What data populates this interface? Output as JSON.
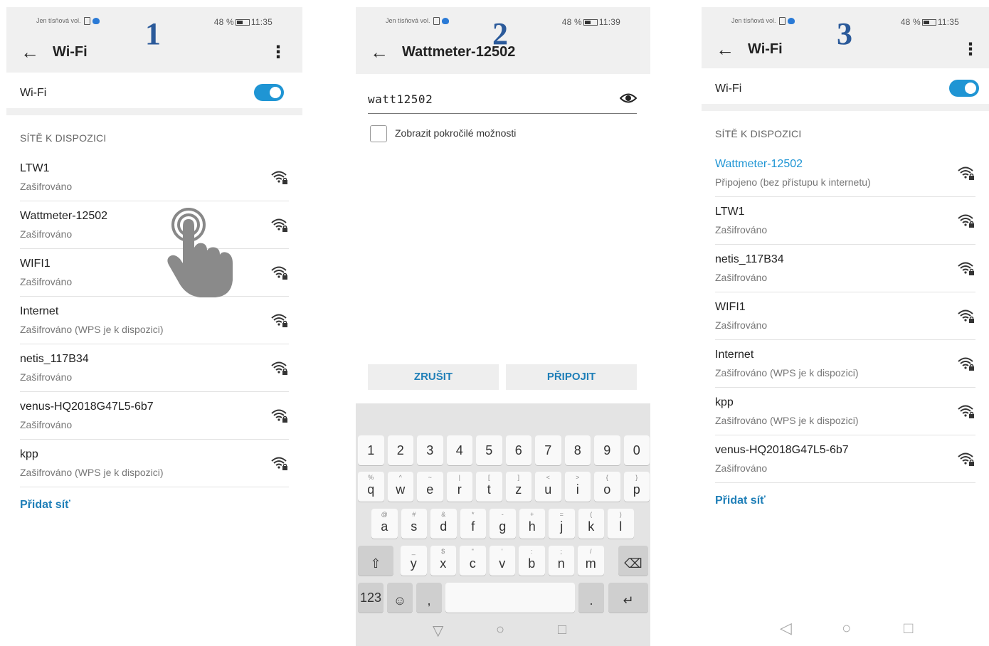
{
  "screens": [
    {
      "step": "1",
      "status": {
        "carrier": "Jen tísňová vol.",
        "battery": "48 %",
        "time": "11:35"
      },
      "title": "Wi-Fi",
      "wifi_label": "Wi-Fi",
      "wifi_on": true,
      "section": "SÍTĚ K DISPOZICI",
      "networks": [
        {
          "name": "LTW1",
          "sub": "Zašifrováno"
        },
        {
          "name": "Wattmeter-12502",
          "sub": "Zašifrováno"
        },
        {
          "name": "WIFI1",
          "sub": "Zašifrováno"
        },
        {
          "name": "Internet",
          "sub": "Zašifrováno (WPS je k dispozici)"
        },
        {
          "name": "netis_117B34",
          "sub": "Zašifrováno"
        },
        {
          "name": "venus-HQ2018G47L5-6b7",
          "sub": "Zašifrováno"
        },
        {
          "name": "kpp",
          "sub": "Zašifrováno (WPS je k dispozici)"
        }
      ],
      "add_network": "Přidat síť"
    },
    {
      "step": "2",
      "status": {
        "carrier": "Jen tísňová vol.",
        "battery": "48 %",
        "time": "11:39"
      },
      "title": "Wattmeter-12502",
      "password": "watt12502",
      "advanced_label": "Zobrazit pokročilé možnosti",
      "cancel": "ZRUŠIT",
      "connect": "PŘIPOJIT",
      "keyboard": {
        "row_numbers": [
          "1",
          "2",
          "3",
          "4",
          "5",
          "6",
          "7",
          "8",
          "9",
          "0"
        ],
        "row1": [
          [
            "q",
            "%"
          ],
          [
            "w",
            "^"
          ],
          [
            "e",
            "~"
          ],
          [
            "r",
            "|"
          ],
          [
            "t",
            "["
          ],
          [
            "z",
            "]"
          ],
          [
            "u",
            "<"
          ],
          [
            "i",
            ">"
          ],
          [
            "o",
            "{"
          ],
          [
            "p",
            "}"
          ]
        ],
        "row2": [
          [
            "a",
            "@"
          ],
          [
            "s",
            "#"
          ],
          [
            "d",
            "&"
          ],
          [
            "f",
            "*"
          ],
          [
            "g",
            "-"
          ],
          [
            "h",
            "+"
          ],
          [
            "j",
            "="
          ],
          [
            "k",
            "("
          ],
          [
            "l",
            ")"
          ]
        ],
        "row3": [
          [
            "y",
            "_"
          ],
          [
            "x",
            "$"
          ],
          [
            "c",
            "\""
          ],
          [
            "v",
            "'"
          ],
          [
            "b",
            ":"
          ],
          [
            "n",
            ";"
          ],
          [
            "m",
            "/"
          ]
        ],
        "sym_key": "123"
      }
    },
    {
      "step": "3",
      "status": {
        "carrier": "Jen tísňová vol.",
        "battery": "48 %",
        "time": "11:35"
      },
      "title": "Wi-Fi",
      "wifi_label": "Wi-Fi",
      "wifi_on": true,
      "section": "SÍTĚ K DISPOZICI",
      "networks": [
        {
          "name": "Wattmeter-12502",
          "sub": "Připojeno (bez přístupu k internetu)",
          "connected": true
        },
        {
          "name": "LTW1",
          "sub": "Zašifrováno"
        },
        {
          "name": "netis_117B34",
          "sub": "Zašifrováno"
        },
        {
          "name": "WIFI1",
          "sub": "Zašifrováno"
        },
        {
          "name": "Internet",
          "sub": "Zašifrováno (WPS je k dispozici)"
        },
        {
          "name": "kpp",
          "sub": "Zašifrováno (WPS je k dispozici)"
        },
        {
          "name": "venus-HQ2018G47L5-6b7",
          "sub": "Zašifrováno"
        }
      ],
      "add_network": "Přidat síť"
    }
  ],
  "colors": {
    "accent": "#1f95d4",
    "link": "#1f7fb8",
    "step_number": "#2b5a9a",
    "header_bg": "#f0f0f0"
  },
  "icons": {
    "back": "arrow-left-icon",
    "menu": "more-vert-icon",
    "signal": "wifi-lock-icon",
    "eye": "eye-icon",
    "hand": "tap-hand-icon"
  }
}
